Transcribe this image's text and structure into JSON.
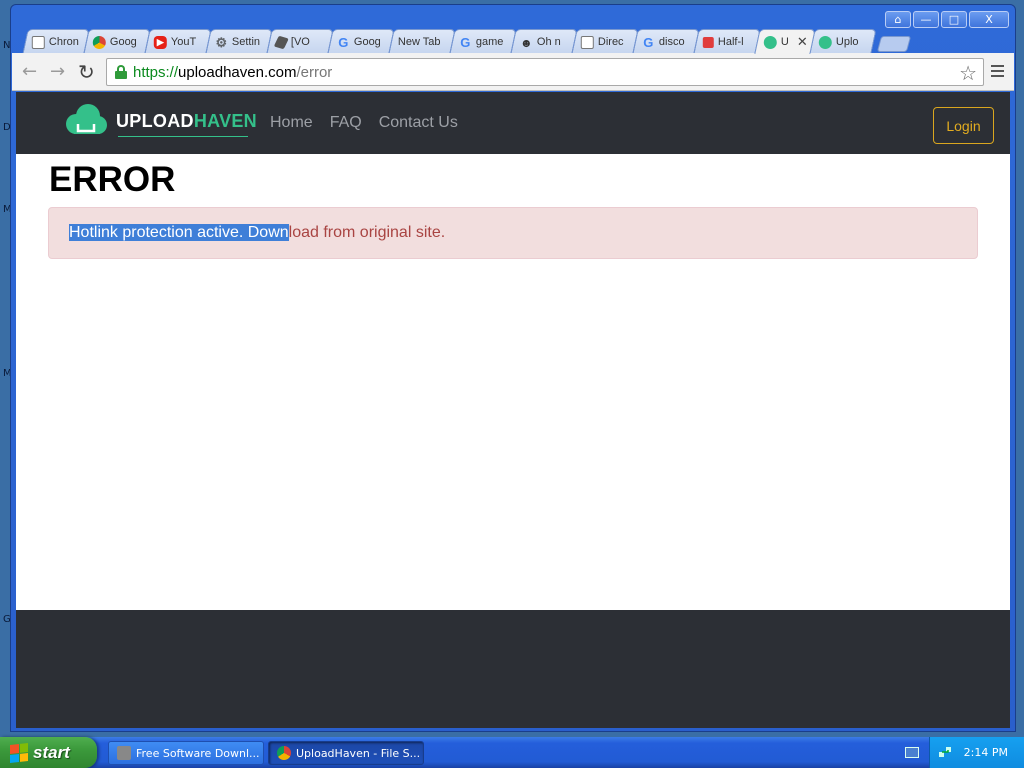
{
  "desktop": {
    "side_letters": [
      "N",
      "D",
      "M",
      "M",
      "G"
    ]
  },
  "window": {
    "controls": {
      "user": "⌂",
      "minimize": "—",
      "maximize": "□",
      "close": "X"
    },
    "tabs": [
      {
        "title": "Chron",
        "icon": "doc-icon",
        "color": "#ffffff"
      },
      {
        "title": "Goog",
        "icon": "chrome-icon",
        "color": "#db4437"
      },
      {
        "title": "YouT",
        "icon": "youtube-icon",
        "color": "#e62117"
      },
      {
        "title": "Settin",
        "icon": "gear-icon",
        "color": "#5f6368"
      },
      {
        "title": "[VO",
        "icon": "roblox-icon",
        "color": "#555555"
      },
      {
        "title": "Goog",
        "icon": "google-icon",
        "color": "#4285f4"
      },
      {
        "title": "New Tab",
        "icon": "none",
        "color": "#ffffff"
      },
      {
        "title": "game",
        "icon": "google-icon",
        "color": "#4285f4"
      },
      {
        "title": "Oh n",
        "icon": "face-icon",
        "color": "#333333"
      },
      {
        "title": "Direc",
        "icon": "doc-icon",
        "color": "#ffffff"
      },
      {
        "title": "disco",
        "icon": "google-icon",
        "color": "#4285f4"
      },
      {
        "title": "Half-l",
        "icon": "lock-red-icon",
        "color": "#e03c3c"
      },
      {
        "title": "U",
        "icon": "uploadhaven-icon",
        "color": "#34c08a",
        "active": true,
        "close": "✕"
      },
      {
        "title": "Uplo",
        "icon": "uploadhaven-icon",
        "color": "#34c08a"
      }
    ],
    "toolbar": {
      "back": "←",
      "forward": "→",
      "reload": "↻",
      "url_scheme": "https://",
      "url_host": "uploadhaven.com",
      "url_path": "/error",
      "bookmark_star": "☆"
    }
  },
  "site": {
    "logo_white": "UPLOAD",
    "logo_green": "HAVEN",
    "nav": [
      "Home",
      "FAQ",
      "Contact Us"
    ],
    "login_label": "Login",
    "error_title": "ERROR",
    "alert_selected": "Hotlink protection active. Down",
    "alert_rest": "load from original site."
  },
  "colors": {
    "navbar_bg": "#2c2f35",
    "brand_green": "#34c08a",
    "login_gold": "#e2ac20",
    "alert_bg": "#f2dede",
    "alert_text": "#a94442",
    "selection": "#3f7fd8"
  },
  "taskbar": {
    "start_label": "start",
    "tasks": [
      "Free Software Downl...",
      "UploadHaven - File S..."
    ],
    "clock": "2:14 PM"
  }
}
